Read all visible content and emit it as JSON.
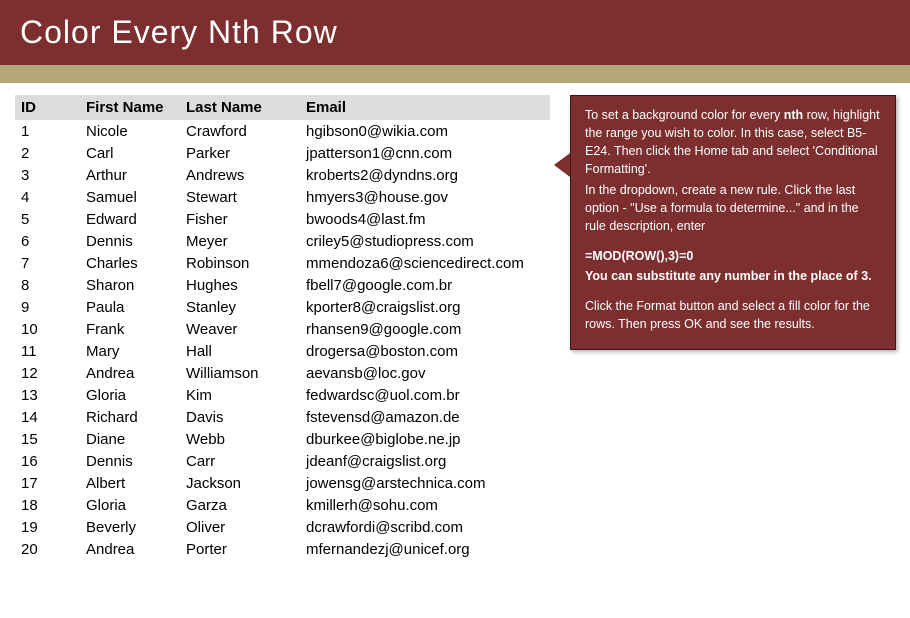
{
  "header": {
    "title": "Color Every Nth Row"
  },
  "table": {
    "headers": {
      "id": "ID",
      "first": "First Name",
      "last": "Last Name",
      "email": "Email"
    },
    "rows": [
      {
        "id": "1",
        "first": "Nicole",
        "last": "Crawford",
        "email": "hgibson0@wikia.com"
      },
      {
        "id": "2",
        "first": "Carl",
        "last": "Parker",
        "email": "jpatterson1@cnn.com"
      },
      {
        "id": "3",
        "first": "Arthur",
        "last": "Andrews",
        "email": "kroberts2@dyndns.org"
      },
      {
        "id": "4",
        "first": "Samuel",
        "last": "Stewart",
        "email": "hmyers3@house.gov"
      },
      {
        "id": "5",
        "first": "Edward",
        "last": "Fisher",
        "email": "bwoods4@last.fm"
      },
      {
        "id": "6",
        "first": "Dennis",
        "last": "Meyer",
        "email": "criley5@studiopress.com"
      },
      {
        "id": "7",
        "first": "Charles",
        "last": "Robinson",
        "email": "mmendoza6@sciencedirect.com"
      },
      {
        "id": "8",
        "first": "Sharon",
        "last": "Hughes",
        "email": "fbell7@google.com.br"
      },
      {
        "id": "9",
        "first": "Paula",
        "last": "Stanley",
        "email": "kporter8@craigslist.org"
      },
      {
        "id": "10",
        "first": "Frank",
        "last": "Weaver",
        "email": "rhansen9@google.com"
      },
      {
        "id": "11",
        "first": "Mary",
        "last": "Hall",
        "email": "drogersa@boston.com"
      },
      {
        "id": "12",
        "first": "Andrea",
        "last": "Williamson",
        "email": "aevansb@loc.gov"
      },
      {
        "id": "13",
        "first": "Gloria",
        "last": "Kim",
        "email": "fedwardsc@uol.com.br"
      },
      {
        "id": "14",
        "first": "Richard",
        "last": "Davis",
        "email": "fstevensd@amazon.de"
      },
      {
        "id": "15",
        "first": "Diane",
        "last": "Webb",
        "email": "dburkee@biglobe.ne.jp"
      },
      {
        "id": "16",
        "first": "Dennis",
        "last": "Carr",
        "email": "jdeanf@craigslist.org"
      },
      {
        "id": "17",
        "first": "Albert",
        "last": "Jackson",
        "email": "jowensg@arstechnica.com"
      },
      {
        "id": "18",
        "first": "Gloria",
        "last": "Garza",
        "email": "kmillerh@sohu.com"
      },
      {
        "id": "19",
        "first": "Beverly",
        "last": "Oliver",
        "email": "dcrawfordi@scribd.com"
      },
      {
        "id": "20",
        "first": "Andrea",
        "last": "Porter",
        "email": "mfernandezj@unicef.org"
      }
    ]
  },
  "callout": {
    "p1a": "To set a background color for every ",
    "p1b": "nth",
    "p1c": " row, highlight the range you wish to color. In this case, select B5-E24. Then click the Home tab and select 'Conditional Formatting'.",
    "p2": "In the dropdown, create a new rule. Click the last option - \"Use a formula to determine...\" and in the rule description, enter",
    "formula": "=MOD(ROW(),3)=0",
    "substitute": "You can substitute any number in the place of 3.",
    "p4": "Click the Format button and select a fill color for the rows. Then press OK and see the results."
  }
}
